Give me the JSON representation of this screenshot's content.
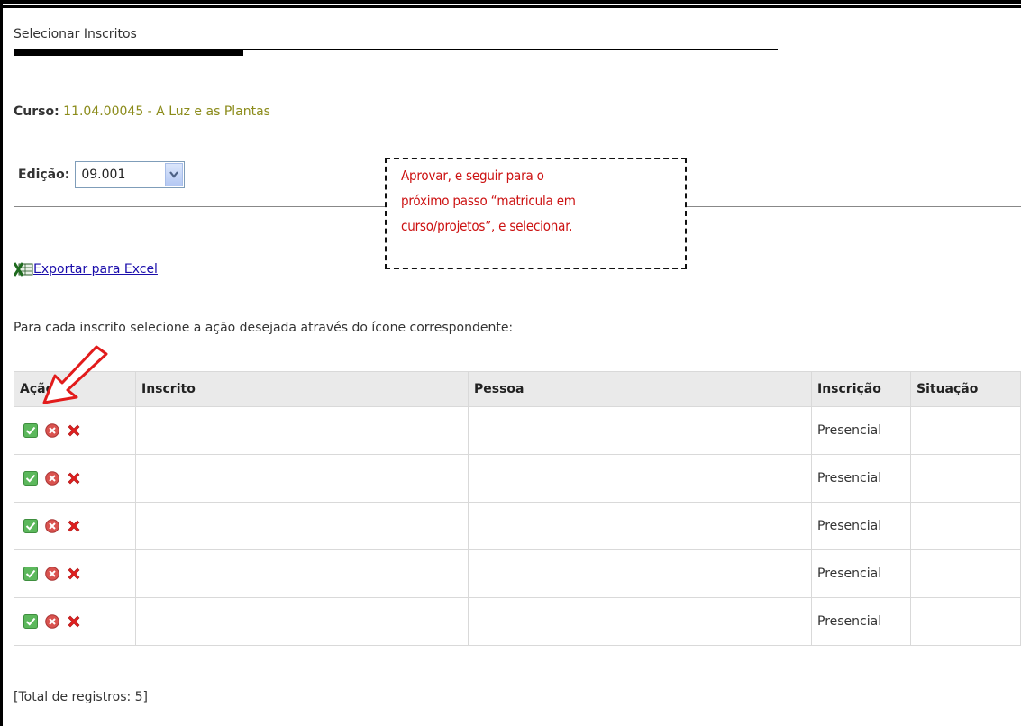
{
  "page": {
    "title": "Selecionar Inscritos"
  },
  "curso": {
    "label": "Curso:",
    "value": "11.04.00045 - A Luz e as Plantas"
  },
  "edicao": {
    "label": "Edição:",
    "selected": "09.001"
  },
  "callout": {
    "line1": "Aprovar, e seguir para o",
    "line2": "próximo passo “matricula em",
    "line3": "curso/projetos”, e selecionar."
  },
  "export": {
    "link_label": "Exportar para Excel",
    "icon": "excel-icon"
  },
  "instructions": "Para cada inscrito selecione a ação desejada através do ícone correspondente:",
  "table": {
    "headers": [
      "Ação",
      "Inscrito",
      "Pessoa",
      "Inscrição",
      "Situação"
    ],
    "rows": [
      {
        "inscrito": "",
        "pessoa": "",
        "inscricao": "Presencial",
        "situacao": ""
      },
      {
        "inscrito": "",
        "pessoa": "",
        "inscricao": "Presencial",
        "situacao": ""
      },
      {
        "inscrito": "",
        "pessoa": "",
        "inscricao": "Presencial",
        "situacao": ""
      },
      {
        "inscrito": "",
        "pessoa": "",
        "inscricao": "Presencial",
        "situacao": ""
      },
      {
        "inscrito": "",
        "pessoa": "",
        "inscricao": "Presencial",
        "situacao": ""
      }
    ],
    "action_icons": [
      "approve-check-icon",
      "cancel-circle-icon",
      "delete-x-icon"
    ]
  },
  "footer": {
    "total": "[Total de registros: 5]"
  },
  "colors": {
    "curso_value": "#8b8b1a",
    "callout_text": "#cc1111",
    "approve": "#4caf50",
    "cancel": "#d9534f",
    "delete": "#e02020",
    "header_bg": "#eaeaea"
  }
}
